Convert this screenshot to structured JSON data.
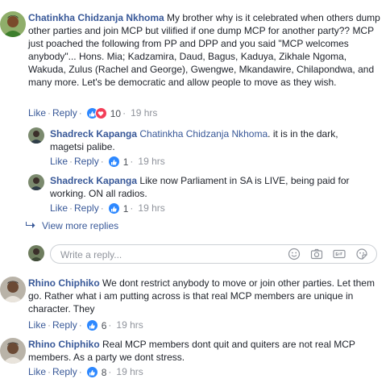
{
  "comments": [
    {
      "author": "Chatinkha Chidzanja Nkhoma",
      "text": "My brother why is it celebrated when others dump other parties and join MCP but vilified if one dump MCP for another party?? MCP just poached the following from PP and DPP and you said \"MCP welcomes anybody\"... Hons. Mia; Kadzamira, Daud, Bagus, Kaduya, Zikhale Ngoma, Wakuda, Zulus (Rachel and George), Gwengwe, Mkandawire, Chilapondwa, and many more. Let's be democratic and allow people to move as they wish.",
      "like": "Like",
      "reply": "Reply",
      "reactions": "10",
      "time": "19 hrs"
    },
    {
      "author": "Rhino Chiphiko",
      "text": "We dont restrict anybody to move or join other parties. Let them go. Rather what i am putting across is that real MCP members are unique in character. They",
      "like": "Like",
      "reply": "Reply",
      "reactions": "6",
      "time": "19 hrs"
    },
    {
      "author": "Rhino Chiphiko",
      "text": "Real MCP members dont quit and quiters are not real MCP members. As a party we dont stress.",
      "like": "Like",
      "reply": "Reply",
      "reactions": "8",
      "time": "19 hrs"
    }
  ],
  "replies": [
    {
      "author": "Shadreck Kapanga",
      "mention": "Chatinkha Chidzanja Nkhoma",
      "text": ". it is in the dark, magetsi palibe.",
      "like": "Like",
      "reply": "Reply",
      "reactions": "1",
      "time": "19 hrs"
    },
    {
      "author": "Shadreck Kapanga",
      "text": "Like now Parliament in SA is LIVE, being paid for working. ON all radios.",
      "like": "Like",
      "reply": "Reply",
      "reactions": "1",
      "time": "19 hrs"
    }
  ],
  "view_more": "View more replies",
  "composer": {
    "placeholder": "Write a reply..."
  },
  "icons": [
    "emoji-icon",
    "camera-icon",
    "gif-icon",
    "sticker-icon"
  ],
  "colors": {
    "link": "#385898",
    "like_reaction": "#2d88ff",
    "love_reaction": "#f33e58"
  }
}
